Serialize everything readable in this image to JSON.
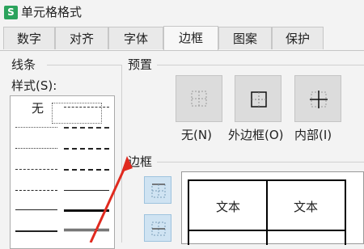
{
  "window": {
    "app_icon": "S",
    "title": "单元格格式"
  },
  "tabs": [
    {
      "label": "数字"
    },
    {
      "label": "对齐"
    },
    {
      "label": "字体"
    },
    {
      "label": "边框"
    },
    {
      "label": "图案"
    },
    {
      "label": "保护"
    }
  ],
  "active_tab": "边框",
  "line_panel": {
    "group_label": "线条",
    "style_label": "样式(S):",
    "none_label": "无"
  },
  "preset_panel": {
    "group_label": "预置",
    "buttons": [
      {
        "label": "无(N)",
        "icon": "no-border-icon"
      },
      {
        "label": "外边框(O)",
        "icon": "outline-border-icon"
      },
      {
        "label": "内部(I)",
        "icon": "inside-border-icon"
      }
    ]
  },
  "border_panel": {
    "group_label": "边框",
    "side_buttons": [
      "top-border-icon",
      "middle-horizontal-border-icon"
    ],
    "preview_cells": [
      "文本",
      "文本"
    ]
  },
  "colors": {
    "accent_blue": "#cfe3f2",
    "annotation_red": "#e02a1f",
    "app_icon_green": "#2ba35c"
  }
}
